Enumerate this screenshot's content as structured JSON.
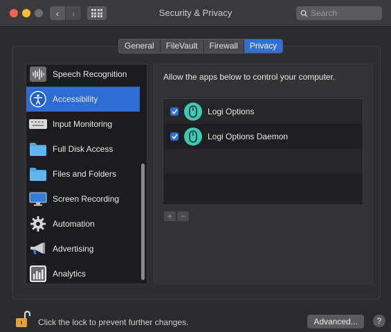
{
  "window": {
    "title": "Security & Privacy",
    "search_placeholder": "Search"
  },
  "tabs": [
    {
      "label": "General",
      "active": false
    },
    {
      "label": "FileVault",
      "active": false
    },
    {
      "label": "Firewall",
      "active": false
    },
    {
      "label": "Privacy",
      "active": true
    }
  ],
  "sidebar": {
    "items": [
      {
        "label": "Speech Recognition",
        "icon": "waveform-icon",
        "active": false
      },
      {
        "label": "Accessibility",
        "icon": "accessibility-icon",
        "active": true
      },
      {
        "label": "Input Monitoring",
        "icon": "keyboard-icon",
        "active": false
      },
      {
        "label": "Full Disk Access",
        "icon": "folder-icon",
        "active": false
      },
      {
        "label": "Files and Folders",
        "icon": "folder-icon",
        "active": false
      },
      {
        "label": "Screen Recording",
        "icon": "display-icon",
        "active": false
      },
      {
        "label": "Automation",
        "icon": "gear-icon",
        "active": false
      },
      {
        "label": "Advertising",
        "icon": "megaphone-icon",
        "active": false
      },
      {
        "label": "Analytics",
        "icon": "bar-chart-icon",
        "active": false
      }
    ]
  },
  "main": {
    "allow_text": "Allow the apps below to control your computer.",
    "apps": [
      {
        "name": "Logi Options",
        "checked": true,
        "icon": "mouse-icon"
      },
      {
        "name": "Logi Options Daemon",
        "checked": true,
        "icon": "mouse-icon"
      }
    ],
    "add_label": "+",
    "remove_label": "−"
  },
  "footer": {
    "lock_text": "Click the lock to prevent further changes.",
    "advanced_label": "Advanced...",
    "help_label": "?"
  },
  "colors": {
    "accent": "#2f6fd6",
    "app_icon": "#3fc9b5",
    "folder": "#4aa8e8",
    "lock": "#e2a13a"
  }
}
